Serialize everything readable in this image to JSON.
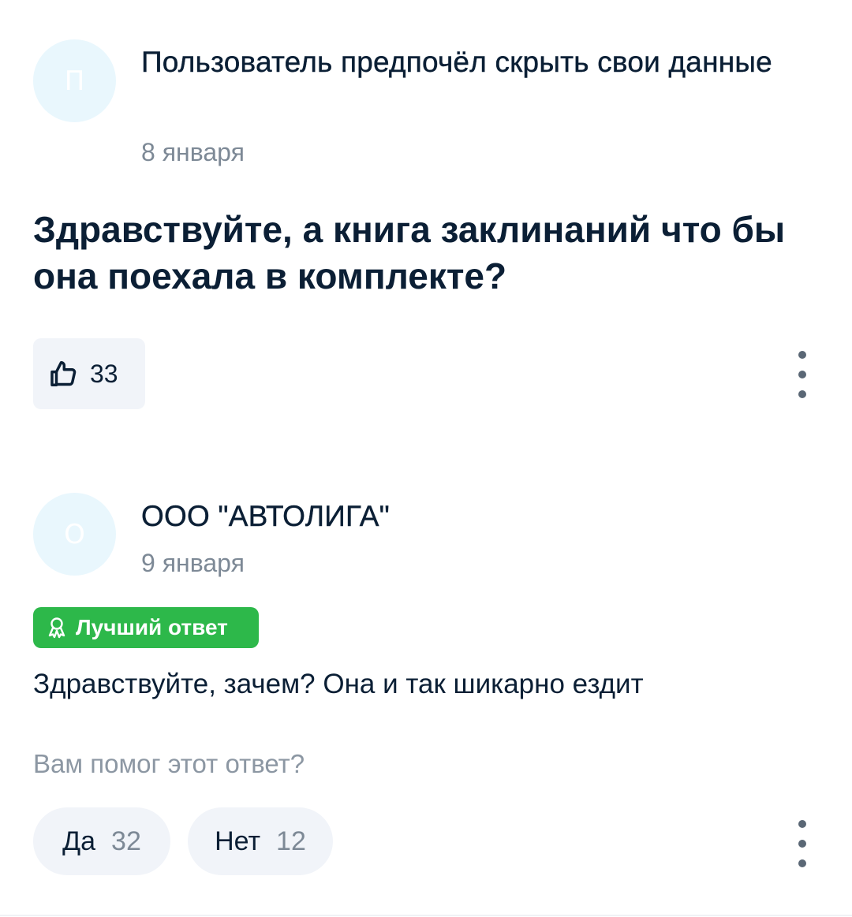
{
  "question_post": {
    "avatar_letter": "П",
    "author": "Пользователь предпочёл скрыть свои данные",
    "date": "8 января",
    "text": "Здравствуйте, а книга заклинаний что бы она поехала в комплекте?",
    "likes": "33",
    "like_icon": "thumbs-up-icon",
    "more_icon": "more-vertical-icon"
  },
  "answer_post": {
    "avatar_letter": "О",
    "author": "ООО \"АВТОЛИГА\"",
    "date": "9 января",
    "badge_label": "Лучший ответ",
    "badge_icon": "award-ribbon-icon",
    "text": "Здравствуйте, зачем? Она и так шикарно ездит",
    "helpful_question": "Вам помог этот ответ?",
    "yes_label": "Да",
    "yes_count": "32",
    "no_label": "Нет",
    "no_count": "12",
    "more_icon": "more-vertical-icon"
  },
  "colors": {
    "badge_green": "#2db84a",
    "avatar_bg": "#e9f7fd",
    "button_bg": "#f1f4f9",
    "text_primary": "#0b1f35",
    "text_secondary": "#7d8996"
  }
}
